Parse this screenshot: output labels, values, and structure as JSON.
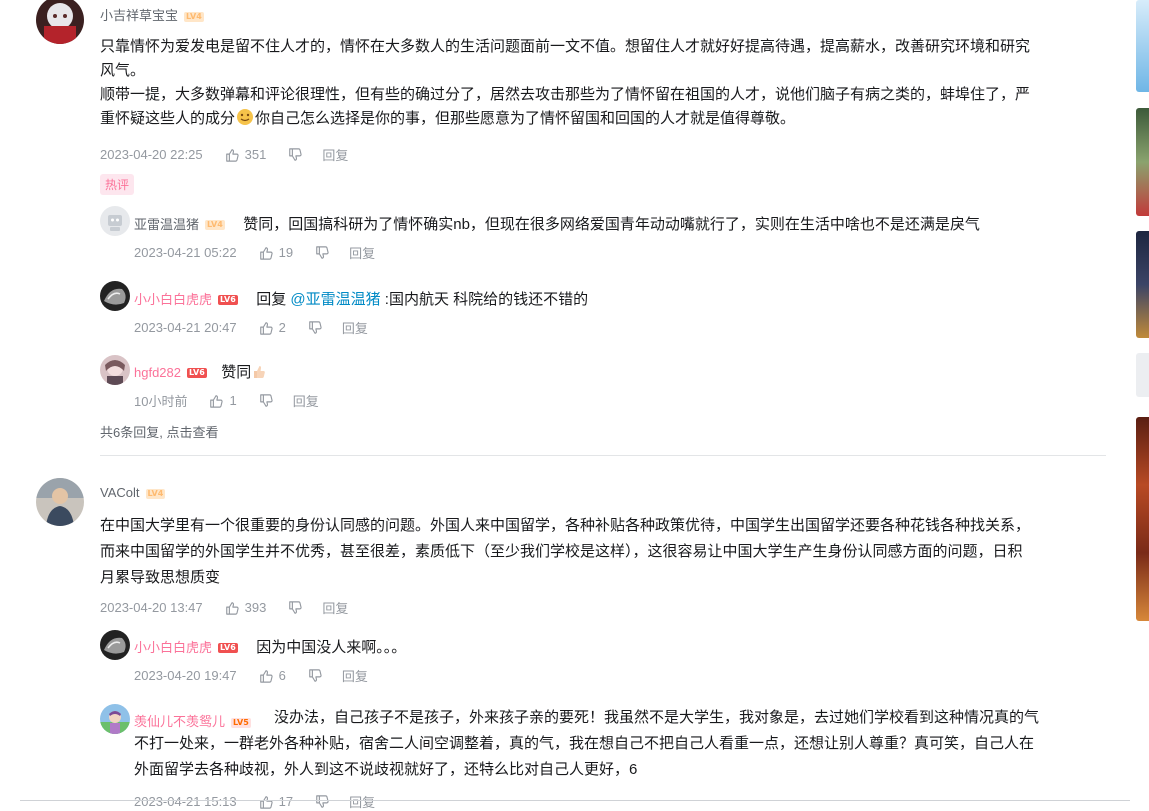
{
  "comments": [
    {
      "username": "小吉祥草宝宝",
      "level": "LV4",
      "text_line1": "只靠情怀为爱发电是留不住人才的，情怀在大多数人的生活问题面前一文不值。想留住人才就好好提高待遇，提高薪水，改善研究环境和研究",
      "text_line2": "风气。",
      "text_line3": "顺带一提，大多数弹幕和评论很理性，但有些的确过分了，居然去攻击那些为了情怀留在祖国的人才，说他们脑子有病之类的，蚌埠住了，严",
      "text_line4_a": "重怀疑这些人的成分",
      "text_line4_b": "你自己怎么选择是你的事，但那些愿意为了情怀留国和回国的人才就是值得尊敬。",
      "time": "2023-04-20 22:25",
      "likes": "351",
      "reply_label": "回复",
      "hot_tag": "热评",
      "replies": [
        {
          "username": "亚雷温温猪",
          "level": "LV4",
          "text": "赞同，回国搞科研为了情怀确实nb，但现在很多网络爱国青年动动嘴就行了，实则在生活中啥也不是还满是戾气",
          "time": "2023-04-21 05:22",
          "likes": "19",
          "reply_label": "回复"
        },
        {
          "username": "小小白白虎虎",
          "level": "LV6",
          "text_prefix": "回复 ",
          "mention": "@亚雷温温猪",
          "text_suffix": " :国内航天 科院给的钱还不错的",
          "time": "2023-04-21 20:47",
          "likes": "2",
          "reply_label": "回复"
        },
        {
          "username": "hgfd282",
          "level": "LV6",
          "text": "赞同",
          "time": "10小时前",
          "likes": "1",
          "reply_label": "回复"
        }
      ],
      "more_replies": "共6条回复, 点击查看"
    },
    {
      "username": "VAColt",
      "level": "LV4",
      "text_line1": "在中国大学里有一个很重要的身份认同感的问题。外国人来中国留学，各种补贴各种政策优待，中国学生出国留学还要各种花钱各种找关系，",
      "text_line2": "而来中国留学的外国学生并不优秀，甚至很差，素质低下（至少我们学校是这样），这很容易让中国大学生产生身份认同感方面的问题，日积",
      "text_line3": "月累导致思想质变",
      "time": "2023-04-20 13:47",
      "likes": "393",
      "reply_label": "回复",
      "replies": [
        {
          "username": "小小白白虎虎",
          "level": "LV6",
          "text": "因为中国没人来啊。。。",
          "time": "2023-04-20 19:47",
          "likes": "6",
          "reply_label": "回复"
        },
        {
          "username": "羡仙儿不羡鸳儿",
          "level": "LV5",
          "text_line1": "没办法，自己孩子不是孩子，外来孩子亲的要死！我虽然不是大学生，我对象是，去过她们学校看到这种情况真的气",
          "text_line2": "不打一处来，一群老外各种补贴，宿舍二人间空调整着，真的气，我在想自己不把自己人看重一点，还想让别人尊重？真可笑，自己人在",
          "text_line3": "外面留学去各种歧视，外人到这不说歧视就好了，还特么比对自己人更好，6",
          "time": "2023-04-21 15:13",
          "likes": "17",
          "reply_label": "回复"
        }
      ]
    }
  ],
  "icons": {
    "like": "thumb-up-icon",
    "dislike": "thumb-down-icon",
    "emoji": "emoji-icon",
    "thumbs_emoji": "thumbs-up-emoji-icon"
  },
  "colors": {
    "vip_name": "#fb7299",
    "mention": "#008ac5",
    "meta": "#9499a0"
  }
}
